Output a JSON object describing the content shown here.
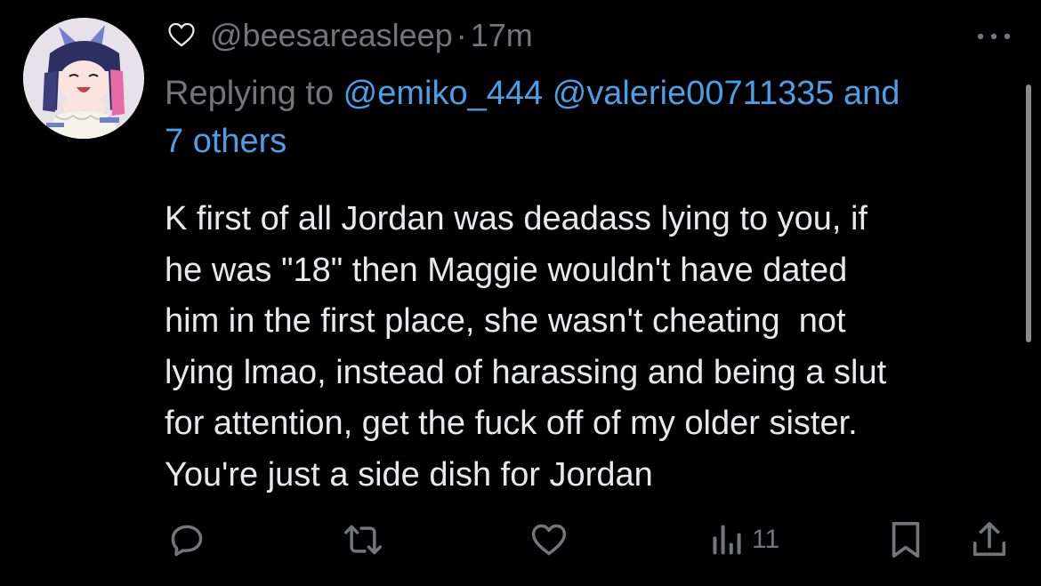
{
  "tweet": {
    "handle": "@beesareasleep",
    "separator": "·",
    "time": "17m",
    "replying_to_prefix": "Replying to ",
    "mentions": [
      "@emiko_444",
      "@valerie00711335"
    ],
    "and_text": " and",
    "others_text": "7 others",
    "body": "K first of all Jordan was deadass lying to you, if\nhe was \"18\" then Maggie wouldn't have dated\nhim in the first place, she wasn't cheating  not\nlying lmao, instead of harassing and being a slut\nfor attention, get the fuck off of my older sister.\nYou're just a side dish for Jordan"
  },
  "actions": {
    "reply_icon": "reply-icon",
    "retweet_icon": "retweet-icon",
    "like_icon": "heart-icon",
    "views_icon": "views-icon",
    "views_count": "11",
    "bookmark_icon": "bookmark-icon",
    "share_icon": "share-icon"
  },
  "colors": {
    "background": "#000000",
    "text": "#e7e9ea",
    "secondary": "#71767b",
    "link": "#4a9fe6"
  }
}
